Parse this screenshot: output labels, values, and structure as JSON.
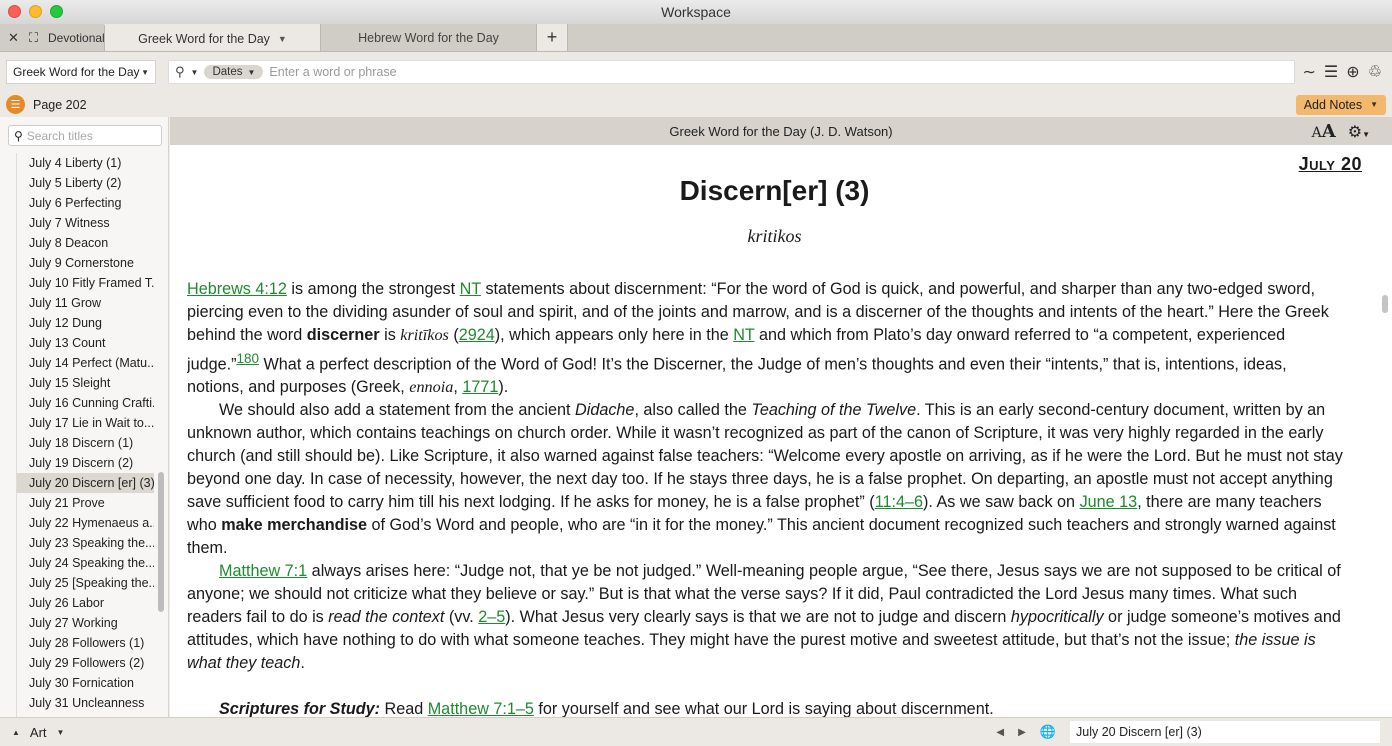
{
  "window": {
    "title": "Workspace"
  },
  "tabbar": {
    "panel_label": "Devotionals",
    "tabs": [
      {
        "label": "Greek Word for the Day",
        "active": true
      },
      {
        "label": "Hebrew Word for the Day",
        "active": false
      }
    ],
    "add_label": "+"
  },
  "toolbar": {
    "book": "Greek Word for the Day",
    "search_scope": "Dates",
    "search_placeholder": "Enter a word or phrase"
  },
  "pagebar": {
    "page": "Page 202",
    "add_notes": "Add Notes"
  },
  "sidebar": {
    "search_placeholder": "Search titles",
    "items": [
      "July 4 Liberty (1)",
      "July 5 Liberty (2)",
      "July 6 Perfecting",
      "July 7 Witness",
      "July 8 Deacon",
      "July 9 Cornerstone",
      "July 10 Fitly Framed T...",
      "July 11 Grow",
      "July 12 Dung",
      "July 13 Count",
      "July 14 Perfect (Matu...",
      "July 15 Sleight",
      "July 16 Cunning Crafti...",
      "July 17 Lie in Wait to...",
      "July 18 Discern (1)",
      "July 19 Discern (2)",
      "July 20 Discern [er]  (3)",
      "July 21 Prove",
      "July 22 Hymenaeus a...",
      "July 23 Speaking the...",
      "July 24 Speaking the...",
      "July 25 [Speaking the...",
      "July 26 Labor",
      "July 27 Working",
      "July 28 Followers (1)",
      "July 29 Followers (2)",
      "July 30 Fornication",
      "July 31 Uncleanness"
    ],
    "selected_index": 16
  },
  "content": {
    "header": "Greek Word for the Day (J. D. Watson)",
    "font_size_label": "A",
    "date": "July 20",
    "title": "Discern[er] (3)",
    "subtitle": "kritikos",
    "p1": {
      "l1": "Hebrews 4:12",
      "t1": " is among the strongest ",
      "l2": "NT",
      "t2": " statements about discernment: “For the word of God is quick, and powerful, and sharper than any two-edged sword, piercing even to the dividing asunder of soul and spirit, and of the joints and marrow, and is a discerner of the thoughts and intents of the heart.” Here the Greek behind the word ",
      "b1": "discerner",
      "t3": " is ",
      "g1": "kritīkos",
      "t4": " (",
      "l3": "2924",
      "t5": "), which appears only here in the ",
      "l4": "NT",
      "t6": " and which from Plato’s day onward referred to “a competent, experienced judge.”",
      "sup": "180",
      "t7": " What a perfect description of the Word of God! It’s the Discerner, the Judge of men’s thoughts and even their “intents,” that is, intentions, ideas, notions, and purposes (Greek, ",
      "g2": "ennoia",
      "t8": ", ",
      "l5": "1771",
      "t9": ")."
    },
    "p2": {
      "t1": "We should also add a statement from the ancient ",
      "i1": "Didache",
      "t2": ", also called the ",
      "i2": "Teaching of the Twelve",
      "t3": ". This is an early second-century document, written by an unknown author, which contains teachings on church order. While it wasn’t recognized as part of the canon of Scripture, it was very highly regarded in the early church (and still should be). Like Scripture, it also warned against false teachers: “Welcome every apostle on arriving, as if he were the Lord. But he must not stay beyond one day. In case of necessity, however, the next day too. If he stays three days, he is a false prophet. On departing, an apostle must not accept anything save sufficient food to carry him till his next lodging. If he asks for money, he is a false prophet” (",
      "l1": "11:4–6",
      "t4": "). As we saw back on ",
      "l2": "June 13",
      "t5": ", there are many teachers who ",
      "b1": "make merchandise",
      "t6": " of God’s Word and people, who are “in it for the money.” This ancient document recognized such teachers and strongly warned against them."
    },
    "p3": {
      "l1": "Matthew 7:1",
      "t1": " always arises here: “Judge not, that ye be not judged.” Well-meaning people argue, “See there, Jesus says we are not supposed to be critical of anyone; we should not criticize what they believe or say.” But is that what the verse says? If it did, Paul contradicted the Lord Jesus many times. What such readers fail to do is ",
      "i1": "read the context",
      "t2": " (vv. ",
      "l2": "2–5",
      "t3": "). What Jesus very clearly says is that we are not to judge and discern ",
      "i2": "hypocritically",
      "t4": " or judge someone’s motives and attitudes, which have nothing to do with what someone teaches. They might have the purest motive and sweetest attitude, but that’s not the issue; ",
      "i3": "the issue is what they teach",
      "t5": "."
    },
    "study": {
      "label": "Scriptures for Study:",
      "t1": " Read ",
      "l1": "Matthew 7:1–5",
      "t2": " for yourself and see what our Lord is saying about discernment."
    }
  },
  "statusbar": {
    "layout": "Art",
    "location": "July 20 Discern [er]  (3)"
  }
}
